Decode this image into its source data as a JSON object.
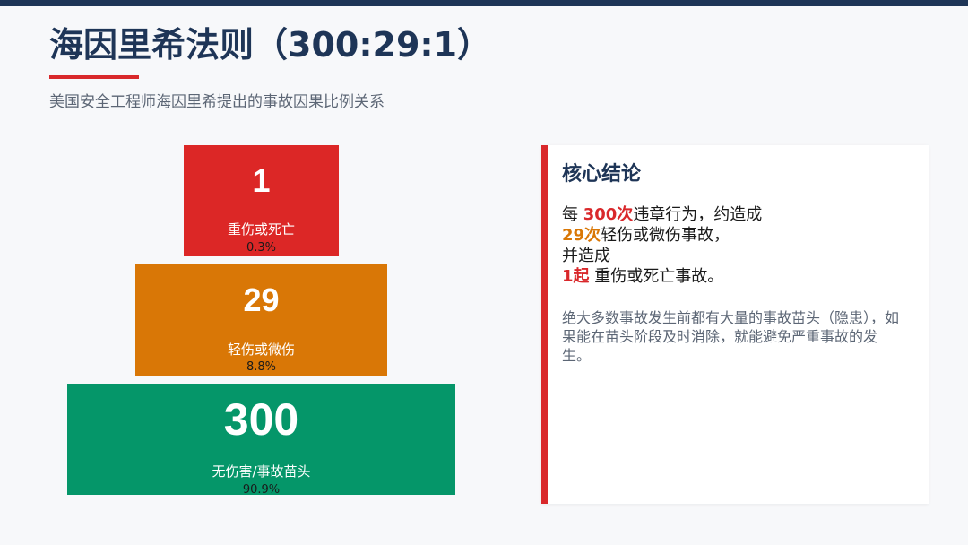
{
  "header": {
    "title": "海因里希法则（300:29:1）",
    "subtitle": "美国安全工程师海因里希提出的事故因果比例关系"
  },
  "pyramid": {
    "top": {
      "count": "1",
      "label": "重伤或死亡",
      "percent": "0.3%"
    },
    "middle": {
      "count": "29",
      "label": "轻伤或微伤",
      "percent": "8.8%"
    },
    "bottom": {
      "count": "300",
      "label": "无伤害/事故苗头",
      "percent": "90.9%"
    }
  },
  "conclusion": {
    "title": "核心结论",
    "line1_prefix": "每 ",
    "line1_highlight": "300次",
    "line1_suffix": "违章行为，约造成",
    "line2_highlight": "29次",
    "line2_suffix": "轻伤或微伤事故，",
    "line3": "并造成",
    "line4_highlight": "1起",
    "line4_suffix": " 重伤或死亡事故。",
    "note": "绝大多数事故发生前都有大量的事故苗头（隐患），如果能在苗头阶段及时消除，就能避免严重事故的发生。"
  },
  "colors": {
    "navy": "#1e3557",
    "red": "#dc2726",
    "orange": "#d97706",
    "green": "#059669"
  }
}
